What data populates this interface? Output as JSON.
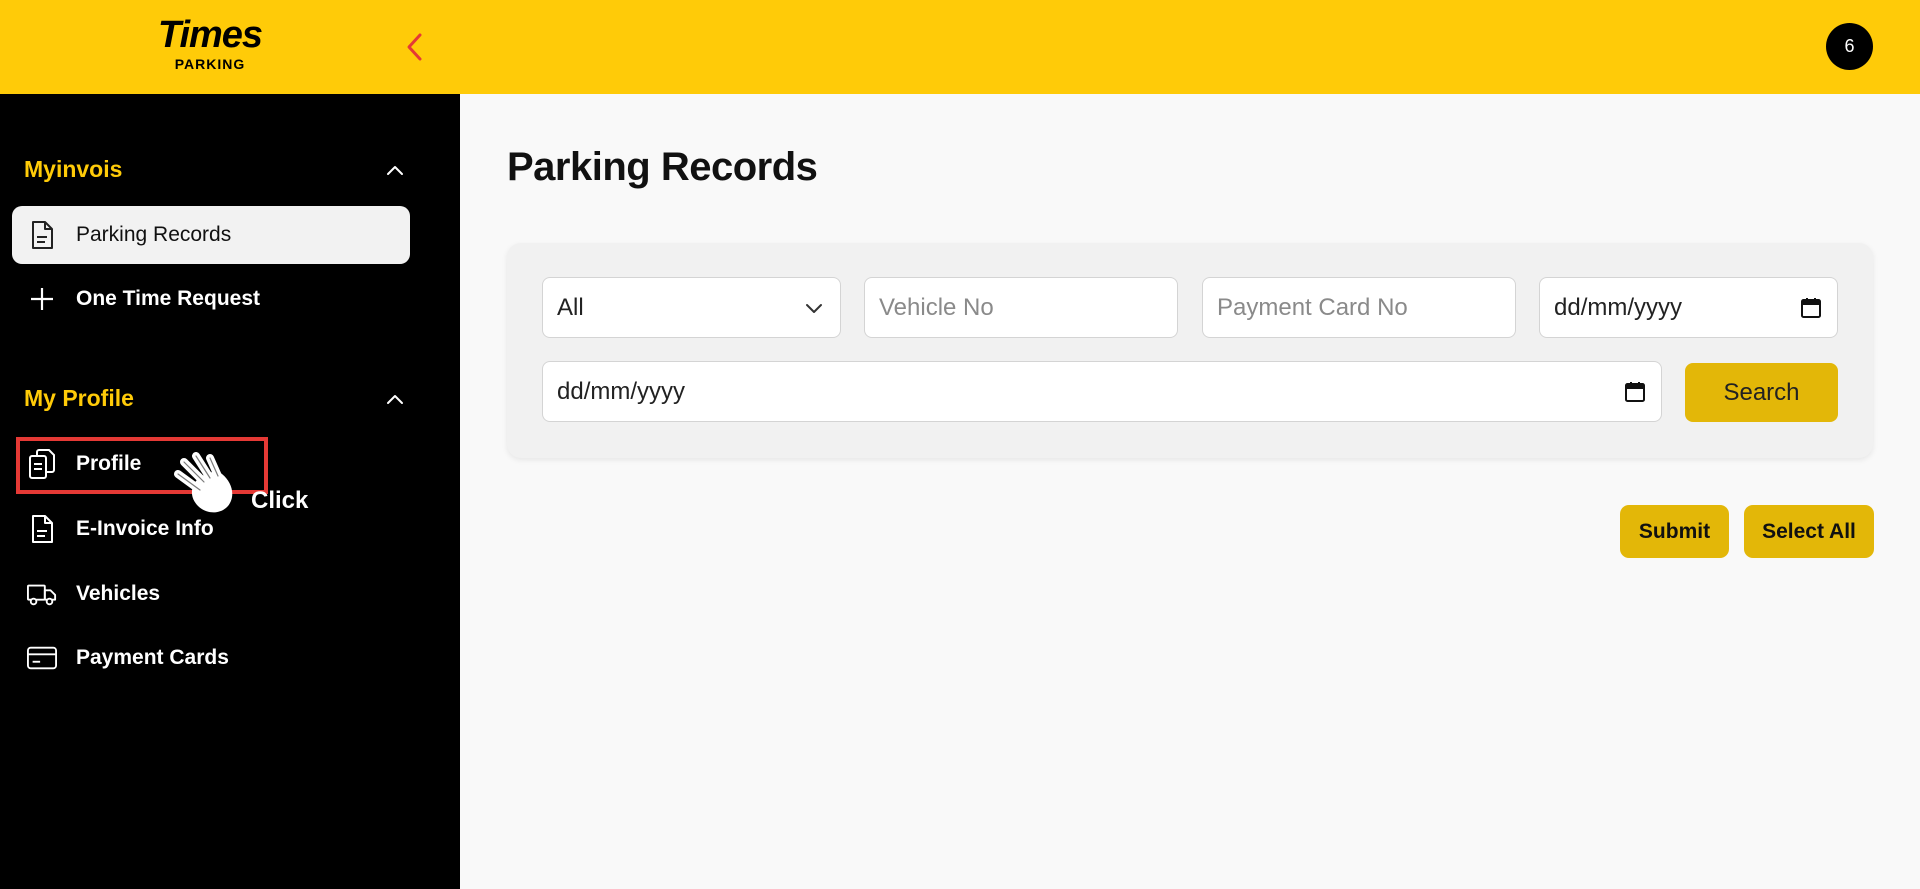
{
  "header": {
    "logo_main": "Times",
    "logo_sub": "PARKING",
    "notification_count": "6",
    "accent_color": "#ffcb08",
    "back_color": "#e53935"
  },
  "sidebar": {
    "sections": [
      {
        "title": "Myinvois",
        "items": [
          {
            "label": "Parking Records",
            "icon": "document-icon",
            "active": true
          },
          {
            "label": "One Time Request",
            "icon": "plus-icon",
            "active": false
          }
        ]
      },
      {
        "title": "My Profile",
        "items": [
          {
            "label": "Profile",
            "icon": "clipboard-icon",
            "active": false
          },
          {
            "label": "E-Invoice Info",
            "icon": "document-icon",
            "active": false
          },
          {
            "label": "Vehicles",
            "icon": "truck-icon",
            "active": false
          },
          {
            "label": "Payment Cards",
            "icon": "credit-card-icon",
            "active": false
          }
        ]
      }
    ]
  },
  "annotation": {
    "label": "Click",
    "highlight_color": "#e53935"
  },
  "main": {
    "title": "Parking Records",
    "filters": {
      "type_select": "All",
      "vehicle_placeholder": "Vehicle No",
      "card_placeholder": "Payment Card No",
      "date_from": "dd/mm/yyyy",
      "date_to": "dd/mm/yyyy",
      "search_label": "Search"
    },
    "actions": {
      "submit_label": "Submit",
      "select_all_label": "Select All"
    },
    "button_color": "#e3b708"
  }
}
